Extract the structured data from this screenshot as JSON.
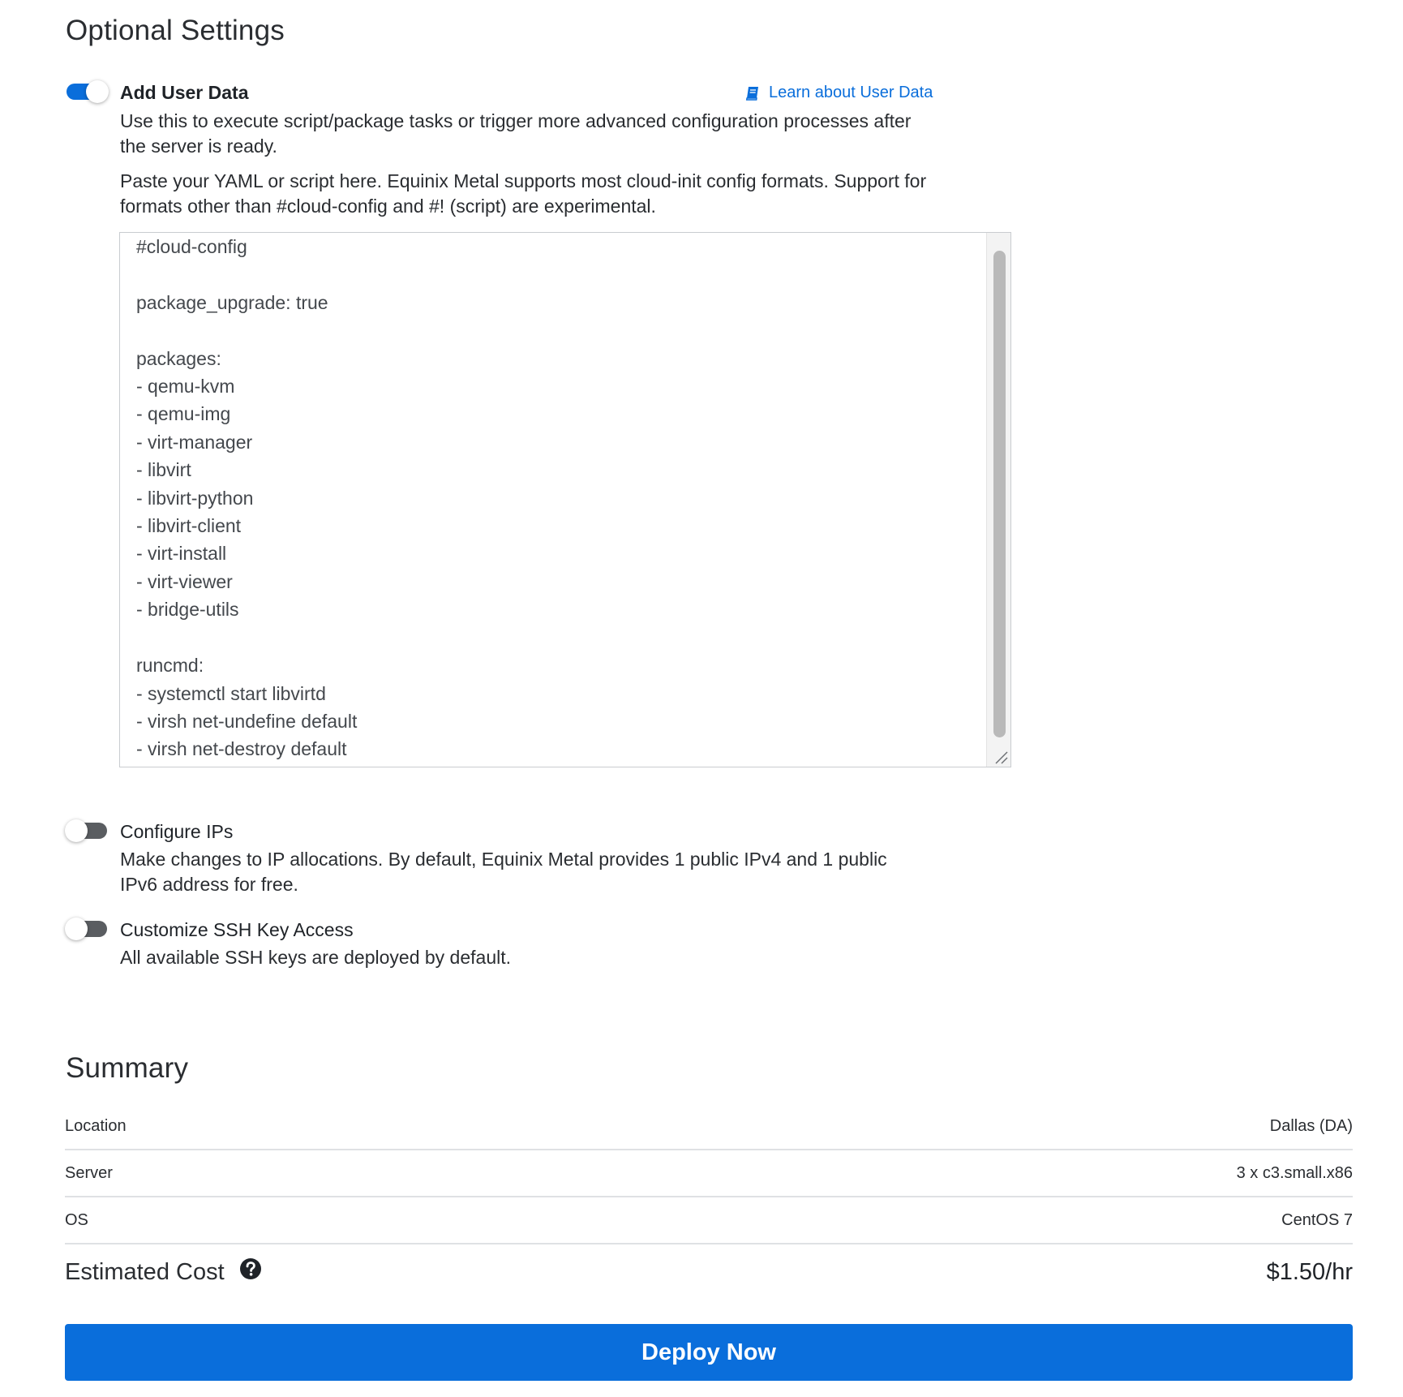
{
  "optional_settings": {
    "title": "Optional Settings",
    "user_data": {
      "label": "Add User Data",
      "enabled": true,
      "learn_link": "Learn about User Data",
      "learn_icon": "book-icon",
      "description": "Use this to execute script/package tasks or trigger more advanced configuration processes after the server is ready.",
      "instructions": "Paste your YAML or script here. Equinix Metal supports most cloud-init config formats. Support for formats other than #cloud-config and #! (script) are experimental.",
      "script": "#cloud-config\n\npackage_upgrade: true\n\npackages:\n- qemu-kvm\n- qemu-img\n- virt-manager\n- libvirt\n- libvirt-python\n- libvirt-client\n- virt-install\n- virt-viewer\n- bridge-utils\n\nruncmd:\n- systemctl start libvirtd\n- virsh net-undefine default\n- virsh net-destroy default"
    },
    "configure_ips": {
      "label": "Configure IPs",
      "enabled": false,
      "description": "Make changes to IP allocations. By default, Equinix Metal provides 1 public IPv4 and 1 public IPv6 address for free."
    },
    "ssh_keys": {
      "label": "Customize SSH Key Access",
      "enabled": false,
      "description": "All available SSH keys are deployed by default."
    }
  },
  "summary": {
    "title": "Summary",
    "rows": [
      {
        "label": "Location",
        "value": "Dallas (DA)"
      },
      {
        "label": "Server",
        "value": "3 x c3.small.x86"
      },
      {
        "label": "OS",
        "value": "CentOS 7"
      }
    ],
    "estimated_cost": {
      "label": "Estimated Cost",
      "value": "$1.50/hr",
      "help_icon": "question-circle-icon"
    }
  },
  "deploy_button": "Deploy Now",
  "colors": {
    "accent": "#0a6edb",
    "toggle_off": "#5a5d61"
  }
}
